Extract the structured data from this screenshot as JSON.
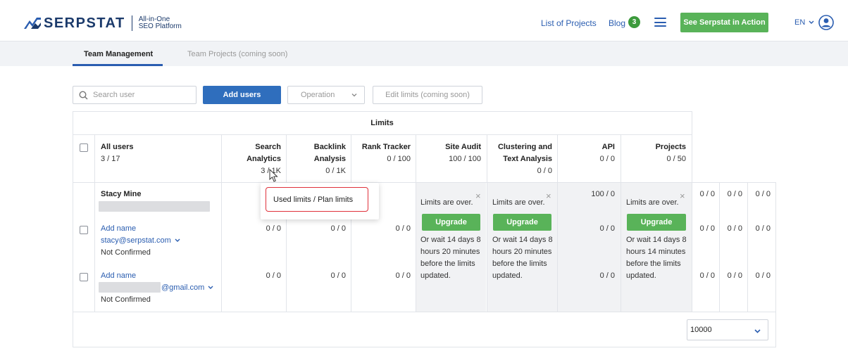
{
  "header": {
    "brand": "SERPSTAT",
    "tagline_line1": "All-in-One",
    "tagline_line2": "SEO Platform",
    "nav_projects": "List of Projects",
    "nav_blog": "Blog",
    "blog_count": "3",
    "cta": "See Serpstat in Action",
    "language": "EN"
  },
  "tabs": {
    "team_management": "Team Management",
    "team_projects": "Team Projects (coming soon)"
  },
  "toolbar": {
    "search_placeholder": "Search user",
    "add_users": "Add users",
    "operation": "Operation",
    "edit_limits": "Edit limits (coming soon)"
  },
  "table": {
    "limits_title": "Limits",
    "all_users_label": "All users",
    "all_users_count": "3 / 17",
    "columns": {
      "search_analytics_1": "Search",
      "search_analytics_2": "Analytics",
      "search_analytics_value": "3 / 1K",
      "backlink_1": "Backlink",
      "backlink_2": "Analysis",
      "backlink_value": "0 / 1K",
      "rank_tracker": "Rank Tracker",
      "rank_tracker_value": "0 / 100",
      "site_audit": "Site Audit",
      "site_audit_value": "100 / 100",
      "clustering_1": "Clustering and",
      "clustering_2": "Text Analysis",
      "clustering_value": "0 / 0",
      "api": "API",
      "api_value": "0 / 0",
      "projects": "Projects",
      "projects_value": "0 / 50"
    },
    "rows": [
      {
        "name": "Stacy Mine",
        "api": "100 / 0",
        "extra": [
          "0 / 0",
          "0 / 0",
          "0 / 0"
        ]
      },
      {
        "name": "Add name",
        "email": "stacy@serpstat.com",
        "status": "Not Confirmed",
        "search": "0 / 0",
        "backlink": "0 / 0",
        "rank": "0 / 0",
        "api": "0 / 0",
        "extra": [
          "0 / 0",
          "0 / 0",
          "0 / 0"
        ]
      },
      {
        "name": "Add name",
        "email": "@gmail.com",
        "status": "Not Confirmed",
        "search": "0 / 0",
        "backlink": "0 / 0",
        "rank": "0 / 0",
        "api": "0 / 0",
        "extra": [
          "0 / 0",
          "0 / 0",
          "0 / 0"
        ]
      }
    ],
    "limit_over": "Limits are over.",
    "upgrade": "Upgrade",
    "wait_line1": "Or wait 14 days 8",
    "wait_line2_a": "hours 20 minutes",
    "wait_line2_b": "hours 14 minutes",
    "wait_line3": "before the limits",
    "wait_line4": "updated.",
    "close": "×"
  },
  "tooltip": {
    "text": "Used limits / Plan limits"
  },
  "pager": {
    "value": "10000"
  },
  "colors": {
    "brand_blue": "#1b3a6b",
    "link_blue": "#2a5db0",
    "green": "#59b359",
    "tooltip_border": "#e0303a"
  }
}
